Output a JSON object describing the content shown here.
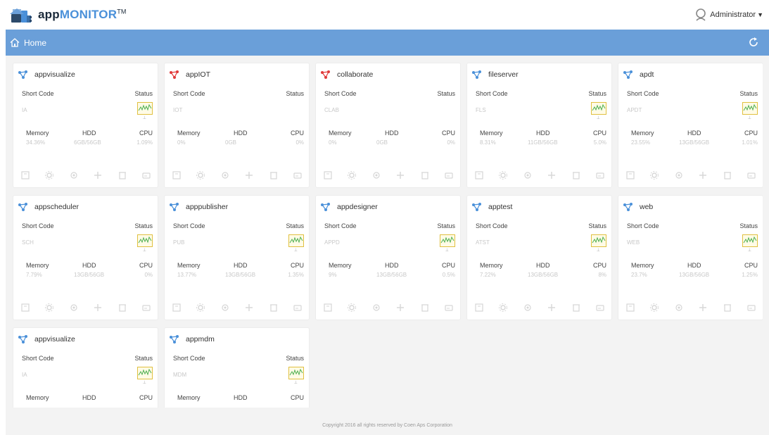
{
  "header": {
    "brand_app": "app",
    "brand_monitor": "MONITOR",
    "brand_tm": "TM",
    "user_label": "Administrator"
  },
  "nav": {
    "home_label": "Home"
  },
  "labels": {
    "short_code": "Short Code",
    "status": "Status",
    "memory": "Memory",
    "hdd": "HDD",
    "cpu": "CPU"
  },
  "colors": {
    "accent": "#6a9fd9",
    "icon_ok": "#4a90d9",
    "icon_alert": "#e03a3a"
  },
  "cards": [
    {
      "name": "appvisualize",
      "icon_state": "ok",
      "short_code": "IA",
      "memory": "34.36%",
      "hdd": "6GB/56GB",
      "cpu": "1.09%",
      "status_shown": true
    },
    {
      "name": "appIOT",
      "icon_state": "alert",
      "short_code": "IOT",
      "memory": "0%",
      "hdd": "0GB",
      "cpu": "0%",
      "status_shown": false
    },
    {
      "name": "collaborate",
      "icon_state": "alert",
      "short_code": "CLAB",
      "memory": "0%",
      "hdd": "0GB",
      "cpu": "0%",
      "status_shown": false
    },
    {
      "name": "fileserver",
      "icon_state": "ok",
      "short_code": "FLS",
      "memory": "8.31%",
      "hdd": "11GB/56GB",
      "cpu": "5.0%",
      "status_shown": true
    },
    {
      "name": "apdt",
      "icon_state": "ok",
      "short_code": "APDT",
      "memory": "23.55%",
      "hdd": "13GB/56GB",
      "cpu": "1.01%",
      "status_shown": true
    },
    {
      "name": "appscheduler",
      "icon_state": "ok",
      "short_code": "SCH",
      "memory": "7.79%",
      "hdd": "13GB/56GB",
      "cpu": "0%",
      "status_shown": true
    },
    {
      "name": "apppublisher",
      "icon_state": "ok",
      "short_code": "PUB",
      "memory": "13.77%",
      "hdd": "13GB/56GB",
      "cpu": "1.35%",
      "status_shown": true
    },
    {
      "name": "appdesigner",
      "icon_state": "ok",
      "short_code": "APPD",
      "memory": "9%",
      "hdd": "13GB/56GB",
      "cpu": "0.5%",
      "status_shown": true
    },
    {
      "name": "apptest",
      "icon_state": "ok",
      "short_code": "ATST",
      "memory": "7.22%",
      "hdd": "13GB/56GB",
      "cpu": "8%",
      "status_shown": true
    },
    {
      "name": "web",
      "icon_state": "ok",
      "short_code": "WEB",
      "memory": "23.7%",
      "hdd": "13GB/56GB",
      "cpu": "1.25%",
      "status_shown": true
    },
    {
      "name": "appvisualize",
      "icon_state": "ok",
      "short_code": "IA",
      "memory": "",
      "hdd": "",
      "cpu": "",
      "status_shown": true
    },
    {
      "name": "appmdm",
      "icon_state": "ok",
      "short_code": "MDM",
      "memory": "",
      "hdd": "",
      "cpu": "",
      "status_shown": true
    }
  ],
  "action_icons": [
    "backup-icon",
    "settings-icon",
    "restart-icon",
    "add-icon",
    "delete-icon",
    "console-icon"
  ],
  "footer": {
    "copyright": "Copyright 2016 all rights reserved by Coen Aps Corporation"
  }
}
